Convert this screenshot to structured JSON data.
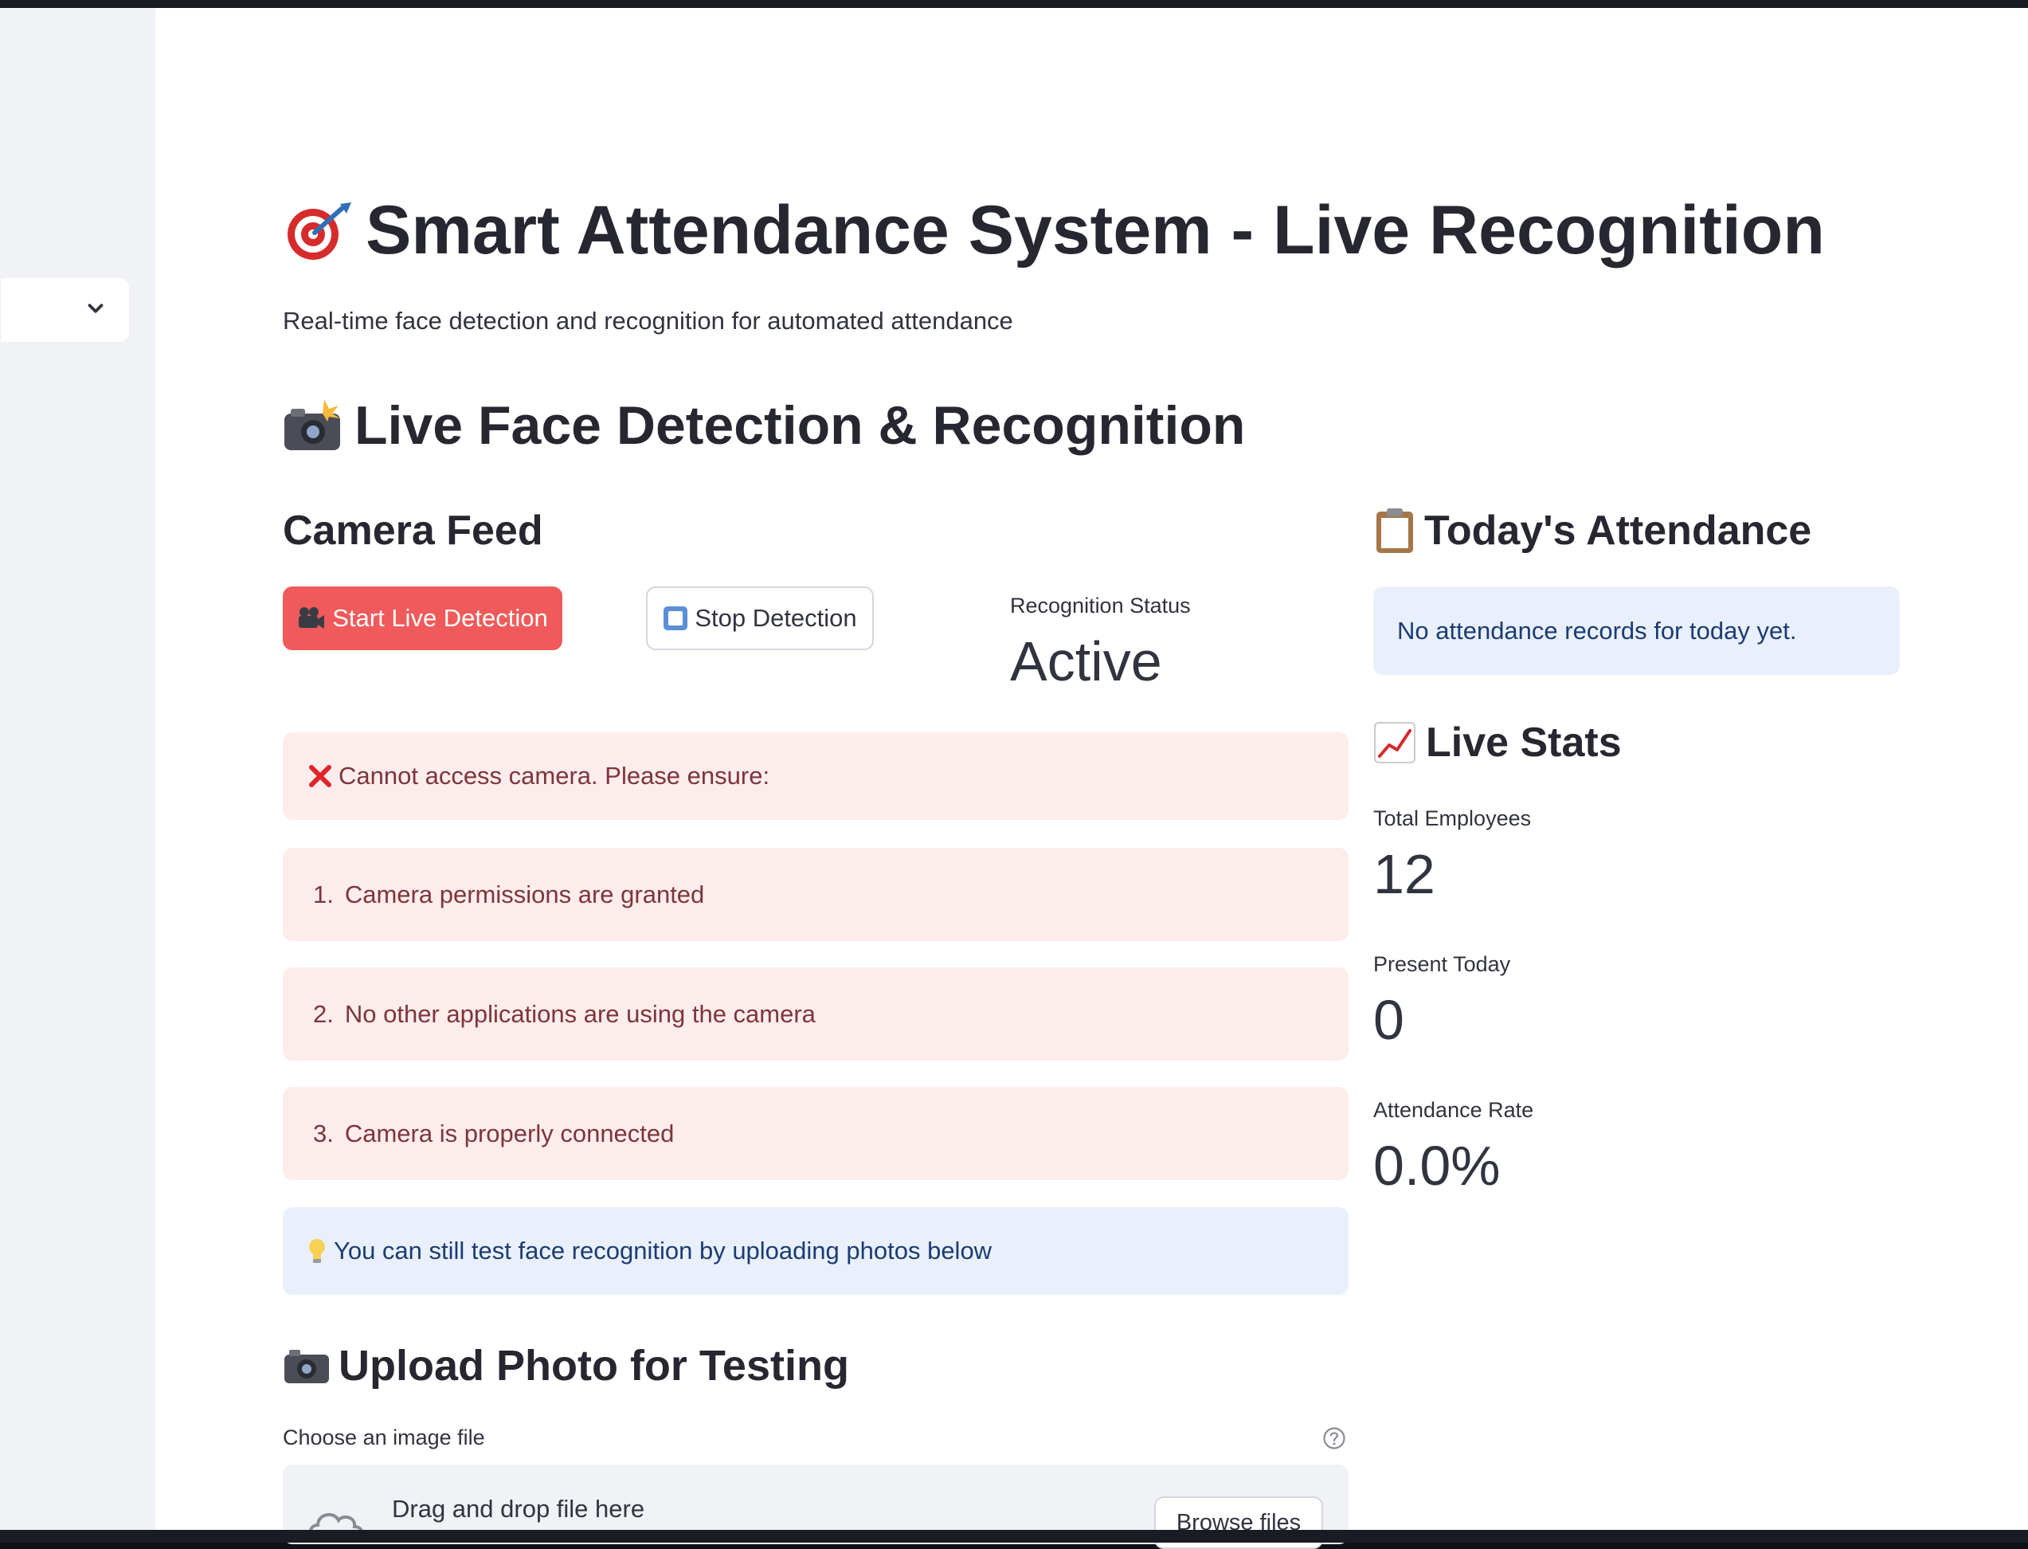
{
  "app": {
    "title": "Smart Attendance System - Live Recognition",
    "subtitle": "Real-time face detection and recognition for automated attendance"
  },
  "icons": {
    "title": "target-dart-icon",
    "live_section": "camera-flash-icon",
    "start_button": "video-camera-icon",
    "stop_button": "stop-square-icon",
    "error": "cross-mark-icon",
    "tip": "light-bulb-icon",
    "upload_section": "camera-icon",
    "attendance": "clipboard-icon",
    "stats": "chart-increasing-icon",
    "help": "question-circle-icon",
    "upload": "cloud-upload-icon"
  },
  "colors": {
    "primary": "#f05a5a",
    "error_bg": "#fdecec",
    "error_text": "#7d353b",
    "info_bg": "#e9f0fb",
    "info_text": "#1b3c72"
  },
  "live_section": {
    "heading": "Live Face Detection & Recognition",
    "camera_feed_heading": "Camera Feed",
    "start_button": "Start Live Detection",
    "stop_button": "Stop Detection",
    "status_label": "Recognition Status",
    "status_value": "Active",
    "error_message": "Cannot access camera. Please ensure:",
    "checklist": [
      {
        "num": "1.",
        "text": "Camera permissions are granted"
      },
      {
        "num": "2.",
        "text": "No other applications are using the camera"
      },
      {
        "num": "3.",
        "text": "Camera is properly connected"
      }
    ],
    "tip": "You can still test face recognition by uploading photos below"
  },
  "upload_section": {
    "heading": "Upload Photo for Testing",
    "label": "Choose an image file",
    "dropzone_text": "Drag and drop file here",
    "browse_button": "Browse files"
  },
  "attendance": {
    "heading": "Today's Attendance",
    "empty_message": "No attendance records for today yet."
  },
  "stats": {
    "heading": "Live Stats",
    "total_label": "Total Employees",
    "total_value": "12",
    "present_label": "Present Today",
    "present_value": "0",
    "rate_label": "Attendance Rate",
    "rate_value": "0.0%"
  }
}
